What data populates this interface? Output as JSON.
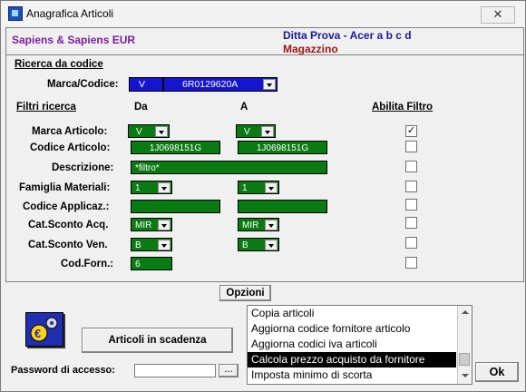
{
  "window": {
    "title": "Anagrafica Articoli",
    "close": "✕"
  },
  "header": {
    "company": "Sapiens & Sapiens EUR",
    "ditta": "Ditta Prova - Acer a b c d",
    "magazzino": "Magazzino"
  },
  "ricerca": {
    "section_title": "Ricerca da codice",
    "marca_codice_label": "Marca/Codice:",
    "marca_value": "V",
    "codice_value": "6R0129620A"
  },
  "filtri": {
    "section_title": "Filtri ricerca",
    "col_da": "Da",
    "col_a": "A",
    "col_abilita": "Abilita Filtro",
    "rows": [
      {
        "label": "Marca Articolo:",
        "da": "V",
        "a": "V",
        "enabled": true
      },
      {
        "label": "Codice Articolo:",
        "da": "1J0698151G",
        "a": "1J0698151G",
        "enabled": false
      },
      {
        "label": "Descrizione:",
        "da": "*filtro*",
        "enabled": false
      },
      {
        "label": "Famiglia Materiali:",
        "da": "1",
        "a": "1",
        "enabled": false
      },
      {
        "label": "Codice Applicaz.:",
        "da": "",
        "a": "",
        "enabled": false
      },
      {
        "label": "Cat.Sconto Acq.",
        "da": "MIR",
        "a": "MIR",
        "enabled": false
      },
      {
        "label": "Cat.Sconto Ven.",
        "da": "B",
        "a": "B",
        "enabled": false
      },
      {
        "label": "Cod.Forn.:",
        "da": "6",
        "enabled": false
      }
    ]
  },
  "bottom": {
    "opzioni_button": "Opzioni",
    "scadenza_button": "Articoli in scadenza",
    "password_label": "Password di accesso:",
    "password_value": "",
    "browse_button": "...",
    "ok_button": "Ok",
    "options_list": [
      "Copia articoli",
      "Aggiorna codice fornitore articolo",
      "Aggiorna codici iva articoli",
      "Calcola prezzo acquisto da fornitore",
      "Imposta minimo di scorta"
    ],
    "selected_option": "Calcola prezzo acquisto da fornitore"
  },
  "colors": {
    "field_green": "#0a7a12",
    "field_blue": "#1515d0",
    "company_purple": "#7a1fa0",
    "ditta_blue": "#1a1a9a",
    "magazzino_red": "#a01515"
  },
  "icons": {
    "app": "app-icon",
    "euro": "euro-settings-icon"
  }
}
